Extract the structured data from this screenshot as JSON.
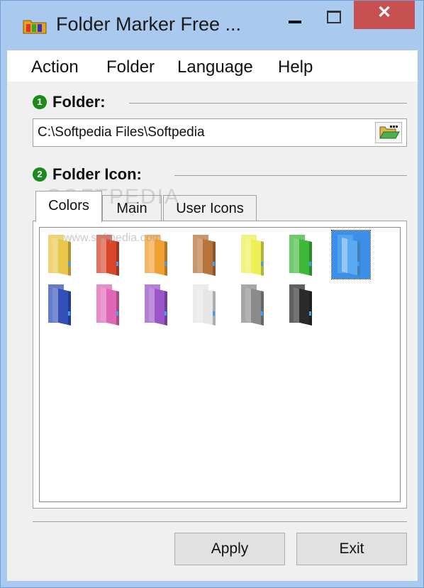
{
  "window": {
    "title": "Folder Marker Free ...",
    "minimize": "minimize",
    "maximize": "maximize",
    "close": "✕"
  },
  "menu": [
    "Action",
    "Folder",
    "Language",
    "Help"
  ],
  "folder_section": {
    "badge": "1",
    "label": "Folder:",
    "path": "C:\\Softpedia Files\\Softpedia",
    "browse_icon": "open-folder-icon"
  },
  "icon_section": {
    "badge": "2",
    "label": "Folder Icon:"
  },
  "tabs": [
    {
      "label": "Colors",
      "active": true
    },
    {
      "label": "Main",
      "active": false
    },
    {
      "label": "User Icons",
      "active": false
    }
  ],
  "folders": [
    {
      "color": "yellow",
      "hex": "#e8c64a",
      "selected": false
    },
    {
      "color": "red",
      "hex": "#d8452a",
      "selected": false
    },
    {
      "color": "orange",
      "hex": "#f0a032",
      "selected": false
    },
    {
      "color": "brown",
      "hex": "#b8733a",
      "selected": false
    },
    {
      "color": "light-yellow",
      "hex": "#eeee55",
      "selected": false
    },
    {
      "color": "green",
      "hex": "#3fb83a",
      "selected": false
    },
    {
      "color": "blue",
      "hex": "#5aaaf0",
      "selected": true
    },
    {
      "color": "dark-blue",
      "hex": "#3250b8",
      "selected": false
    },
    {
      "color": "pink",
      "hex": "#e066b6",
      "selected": false
    },
    {
      "color": "purple",
      "hex": "#9a55c8",
      "selected": false
    },
    {
      "color": "white",
      "hex": "#e6e6e6",
      "selected": false
    },
    {
      "color": "gray",
      "hex": "#8a8a8a",
      "selected": false
    },
    {
      "color": "black",
      "hex": "#2b2b2b",
      "selected": false
    }
  ],
  "watermarks": {
    "large": "SOFTPEDIA",
    "small": "www.softpedia.com"
  },
  "buttons": {
    "apply": "Apply",
    "exit": "Exit"
  },
  "colors": {
    "titlebar": "#a9c9ee",
    "close": "#c75050",
    "badge": "#1c8a1c",
    "selection": "#3d8ee8"
  }
}
